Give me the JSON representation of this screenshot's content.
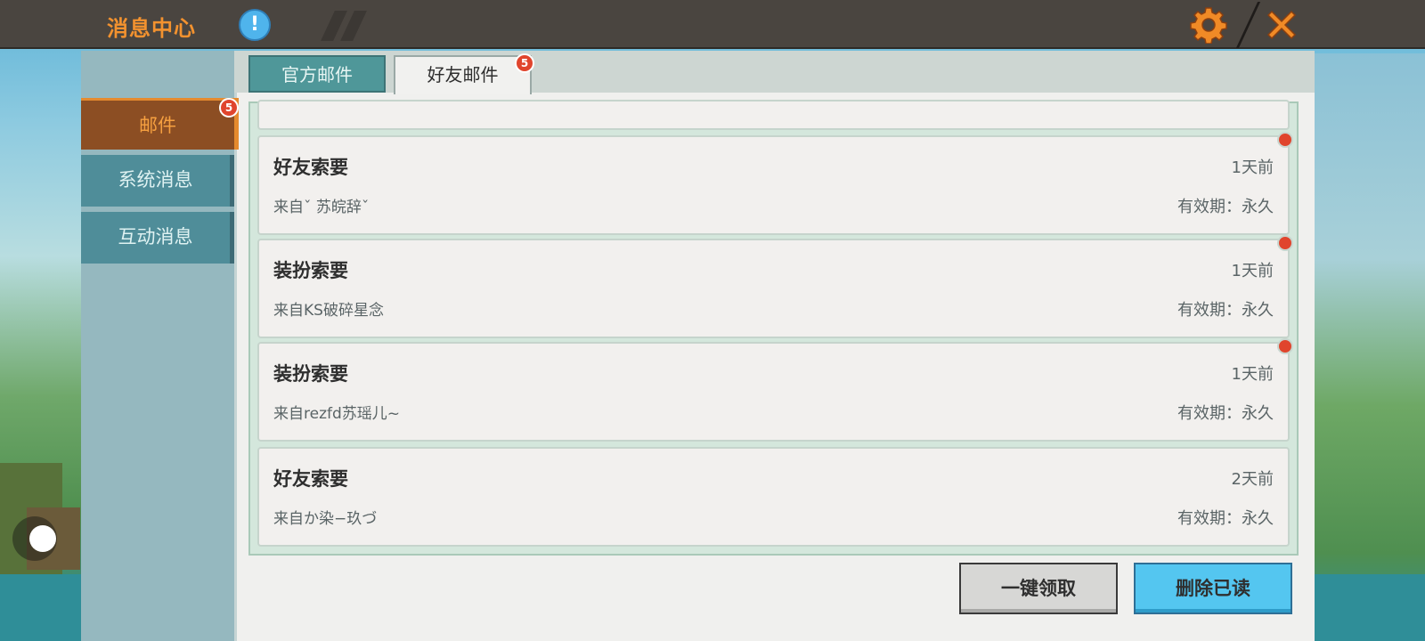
{
  "header": {
    "title": "消息中心",
    "info_icon": "!",
    "settings_icon": "gear-icon",
    "close_icon": "close-icon"
  },
  "sidebar": {
    "items": [
      {
        "label": "邮件",
        "badge": "5",
        "active": true
      },
      {
        "label": "系统消息",
        "active": false
      },
      {
        "label": "互动消息",
        "active": false
      }
    ]
  },
  "tabs": [
    {
      "label": "官方邮件",
      "active": false
    },
    {
      "label": "好友邮件",
      "active": true,
      "badge": "5"
    }
  ],
  "mails": [
    {
      "title": "好友索要",
      "sender": "来自ˇ 苏皖辞ˇ",
      "time": "1天前",
      "validity": "有效期：永久",
      "unread": true
    },
    {
      "title": "装扮索要",
      "sender": "来自KS破碎星念",
      "time": "1天前",
      "validity": "有效期：永久",
      "unread": true
    },
    {
      "title": "装扮索要",
      "sender": "来自rezfd苏瑶儿~",
      "time": "1天前",
      "validity": "有效期：永久",
      "unread": true
    },
    {
      "title": "好友索要",
      "sender": "来自か染−玖づ",
      "time": "2天前",
      "validity": "有效期：永久",
      "unread": false
    }
  ],
  "actions": {
    "claim_all": "一键领取",
    "delete_read": "删除已读"
  },
  "colors": {
    "topbar": "#4a4540",
    "title_orange": "#f3922f",
    "active_side": "#8c4e23",
    "side_item": "#4f8d99",
    "badge_red": "#e0452d",
    "delete_button": "#54c6f0"
  }
}
